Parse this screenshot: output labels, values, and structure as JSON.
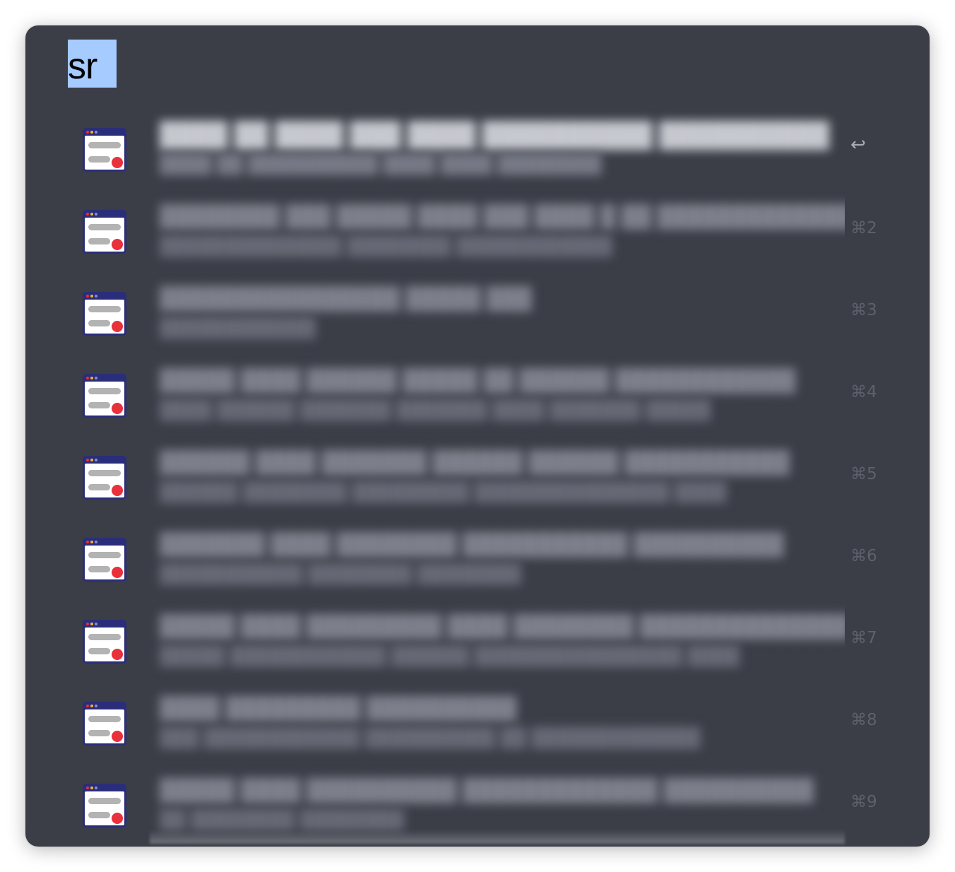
{
  "search": {
    "query": "sr"
  },
  "results": [
    {
      "title": "████ ██ ████ ███ ████ ██████████ ██████████",
      "subtitle": "████ ██ ██████████ ████ ████ ████████",
      "shortcut": "↩"
    },
    {
      "title": "████████ ███ █████ ████ ███ ████ █ ██ █████████████",
      "subtitle": "██████████████ ████████ ████████████",
      "shortcut": "⌘2"
    },
    {
      "title": "████████████████ █████ ███",
      "subtitle": "████████████",
      "shortcut": "⌘3"
    },
    {
      "title": "█████ ████ ██████ █████ ██ ██████ ████████████",
      "subtitle": "████ ██████ ███████ ███████ ████ ███████ █████",
      "shortcut": "⌘4"
    },
    {
      "title": "██████ ████ ███████ ██████ ██████ ███████████",
      "subtitle": "██████ ████████ █████████ ███████████████ ████",
      "shortcut": "⌘5"
    },
    {
      "title": "███████ ████ ████████ ███████████ ██████████",
      "subtitle": "███████████ ████████ ████████",
      "shortcut": "⌘6"
    },
    {
      "title": "█████ ████ █████████ ████ ████████ ██████████████",
      "subtitle": "█████ ████████████ ██████ ████████████████ ████",
      "shortcut": "⌘7"
    },
    {
      "title": "████ █████████ ██████████",
      "subtitle": "███ ████████████ ██████████ ██ █████████████",
      "shortcut": "⌘8"
    },
    {
      "title": "█████ ████ ██████████ █████████████ ██████████",
      "subtitle": "██ ████████ ████████",
      "shortcut": "⌘9"
    }
  ],
  "icons": {
    "result_icon": "web-browser-window-icon"
  },
  "colors": {
    "window_background": "#3b3d47",
    "selection_highlight": "#a6cbff",
    "icon_titlebar": "#2a2e7a",
    "icon_body": "#ffffff",
    "icon_bars": "#b3b3b3",
    "icon_dot": "#e8313b"
  }
}
